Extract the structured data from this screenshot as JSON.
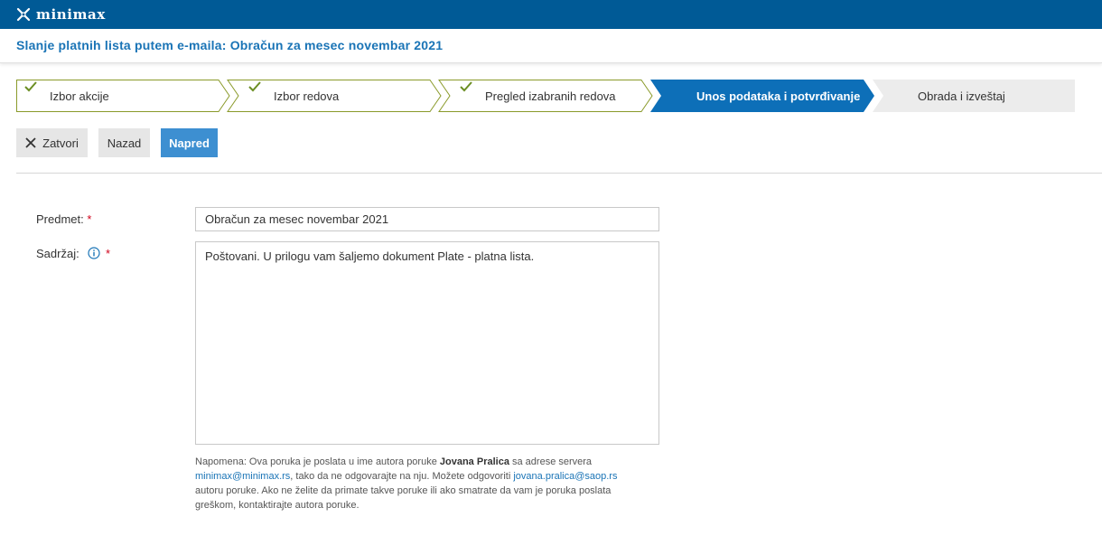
{
  "app": {
    "name": "minimax"
  },
  "page": {
    "title": "Slanje platnih lista putem e-maila: Obračun za mesec novembar 2021"
  },
  "wizard": {
    "steps": [
      {
        "label": "Izbor akcije",
        "state": "done"
      },
      {
        "label": "Izbor redova",
        "state": "done"
      },
      {
        "label": "Pregled izabranih redova",
        "state": "done"
      },
      {
        "label": "Unos podataka i potvrđivanje",
        "state": "active"
      },
      {
        "label": "Obrada i izveštaj",
        "state": "pending"
      }
    ]
  },
  "toolbar": {
    "close_label": "Zatvori",
    "back_label": "Nazad",
    "next_label": "Napred"
  },
  "form": {
    "subject_label": "Predmet:",
    "content_label": "Sadržaj:",
    "required_mark": "*",
    "subject_value": "Obračun za mesec novembar 2021",
    "content_value": "Poštovani. U prilogu vam šaljemo dokument Plate - platna lista."
  },
  "note": {
    "part1": "Napomena: Ova poruka je poslata u ime autora poruke ",
    "author": "Jovana Pralica",
    "part2": " sa adrese servera ",
    "server_email": "minimax@minimax.rs",
    "part3": ", tako da ne odgovarajte na nju. Možete odgovoriti ",
    "author_email": "jovana.pralica@saop.rs",
    "part4": " autoru poruke. Ako ne želite da primate takve poruke ili ako smatrate da vam je poruka poslata greškom, kontaktirajte autora poruke."
  },
  "colors": {
    "brand": "#005a96",
    "accent": "#1a74b6",
    "active_step": "#0d6fb8",
    "done_check": "#6b8e23",
    "required": "#d0021b"
  },
  "icons": {
    "logo": "minimax-logo-icon",
    "check": "check-icon",
    "close": "close-icon",
    "info": "info-icon"
  }
}
